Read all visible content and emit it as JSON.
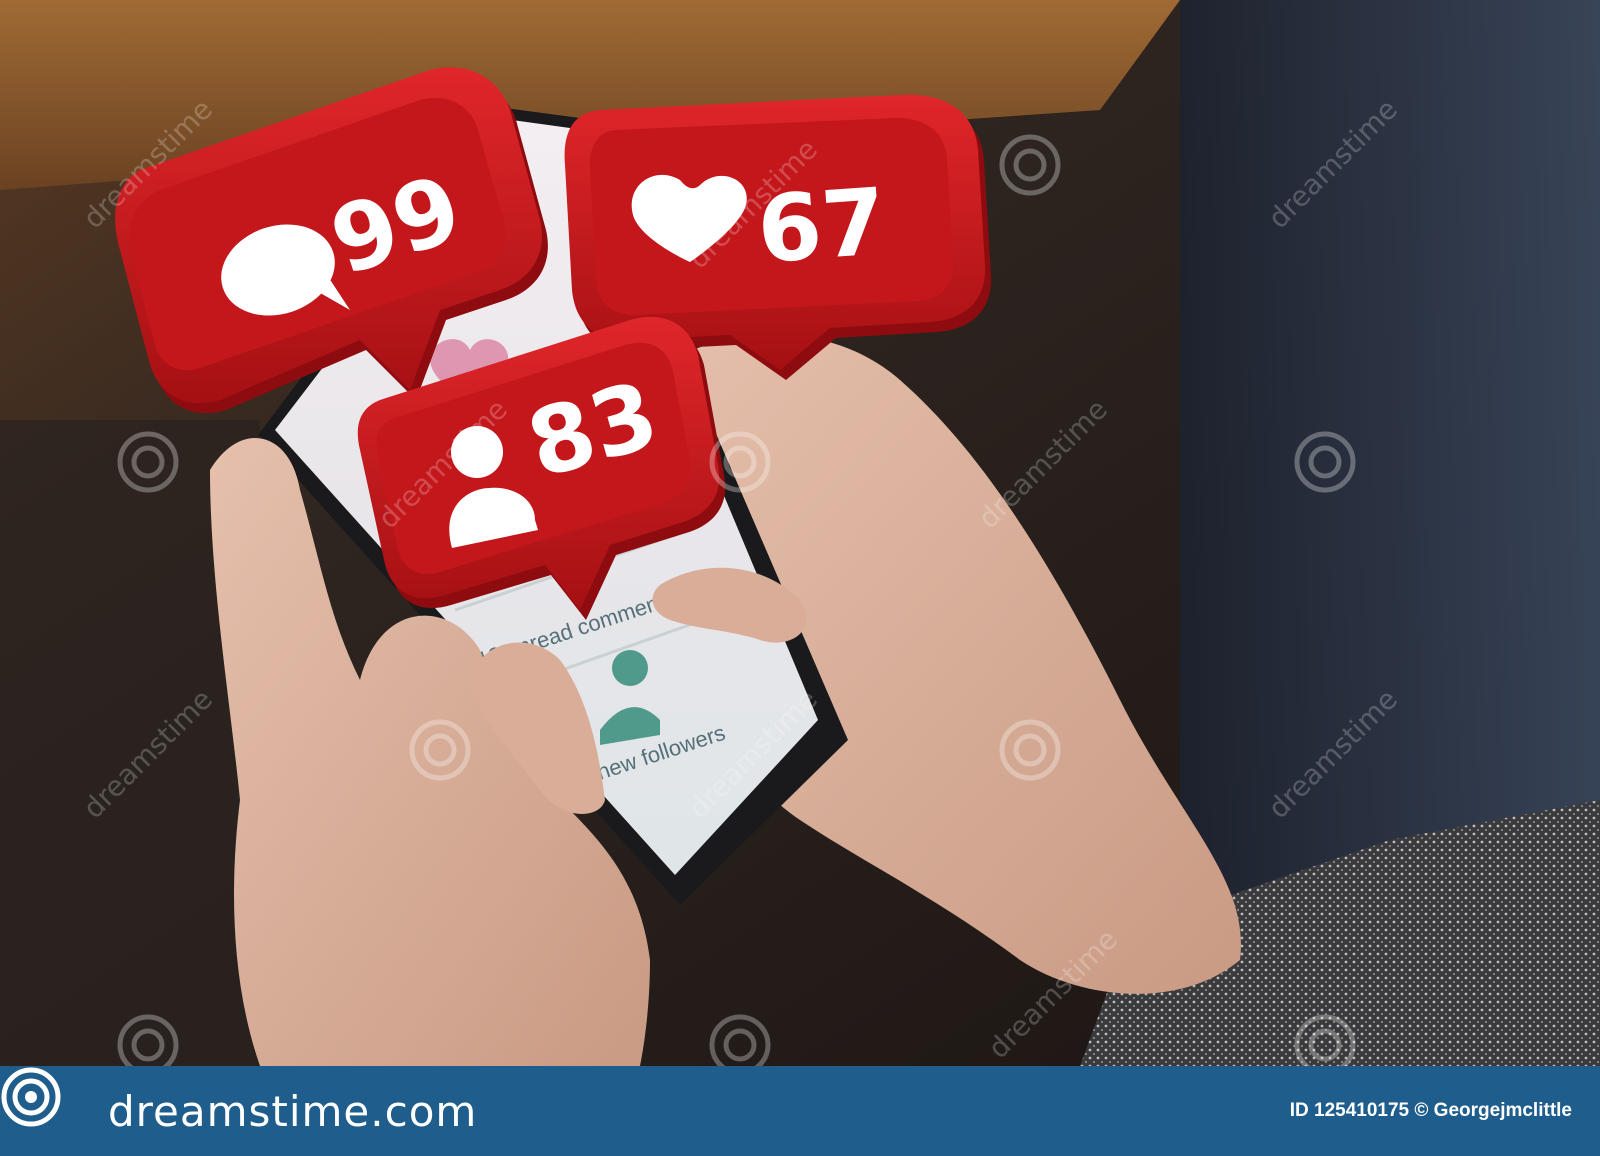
{
  "badges": {
    "comments": {
      "icon": "speech-bubble-icon",
      "count": "99"
    },
    "likes": {
      "icon": "heart-icon",
      "count": "67"
    },
    "followers": {
      "icon": "user-icon",
      "count": "83"
    }
  },
  "phone_screen": {
    "unread_comments": "12 unread comments",
    "new_followers": "new followers"
  },
  "watermark": {
    "text": "dreamstime"
  },
  "footer": {
    "logo_icon": "spiral-icon",
    "brand": "dreamstime.com",
    "credit": "ID 125410175 © Georgejmclittle"
  },
  "colors": {
    "badge_red": "#c4171b",
    "footer_blue": "#1f5d8c"
  }
}
